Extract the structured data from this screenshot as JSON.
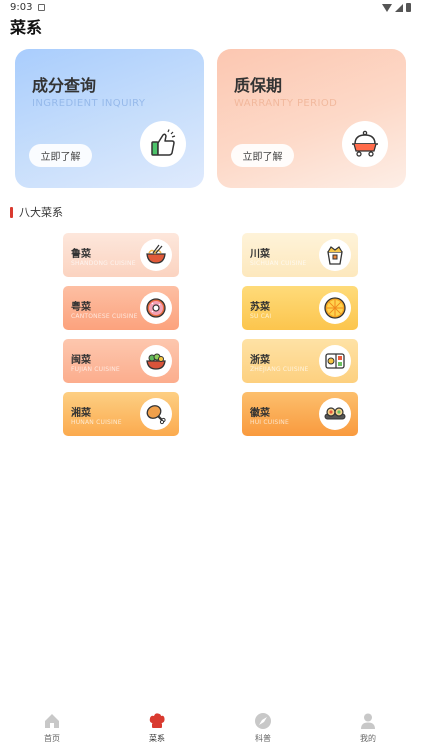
{
  "status_bar": {
    "time": "9:03"
  },
  "page": {
    "title": "菜系"
  },
  "cards": [
    {
      "title": "成分查询",
      "subtitle": "INGREDIENT INQUIRY",
      "button": "立即了解",
      "icon": "thumbs-up-icon"
    },
    {
      "title": "质保期",
      "subtitle": "WARRANTY PERIOD",
      "button": "立即了解",
      "icon": "food-cart-icon"
    }
  ],
  "section": {
    "title": "八大菜系"
  },
  "cuisines": [
    {
      "name": "鲁菜",
      "en": "SHANDONG CUISINE",
      "icon": "noodle-bowl-icon"
    },
    {
      "name": "川菜",
      "en": "SICHUAN CUISINE",
      "icon": "takeout-box-icon"
    },
    {
      "name": "粤菜",
      "en": "CANTONESE CUISINE",
      "icon": "donut-icon"
    },
    {
      "name": "苏菜",
      "en": "SU CAI",
      "icon": "orange-slice-icon"
    },
    {
      "name": "闽菜",
      "en": "FUJIAN CUISINE",
      "icon": "dish-bowl-icon"
    },
    {
      "name": "浙菜",
      "en": "ZHEJIANG CUISINE",
      "icon": "bento-box-icon"
    },
    {
      "name": "湘菜",
      "en": "HUNAN CUISINE",
      "icon": "chicken-leg-icon"
    },
    {
      "name": "徽菜",
      "en": "HUI CUISINE",
      "icon": "sushi-rolls-icon"
    }
  ],
  "tabbar": [
    {
      "label": "首页",
      "icon": "home-icon",
      "active": false
    },
    {
      "label": "菜系",
      "icon": "chef-hat-icon",
      "active": true
    },
    {
      "label": "科普",
      "icon": "compass-icon",
      "active": false
    },
    {
      "label": "我的",
      "icon": "user-icon",
      "active": false
    }
  ],
  "colors": {
    "accent": "#d93a2f",
    "tab_inactive": "#c8c8c8"
  }
}
